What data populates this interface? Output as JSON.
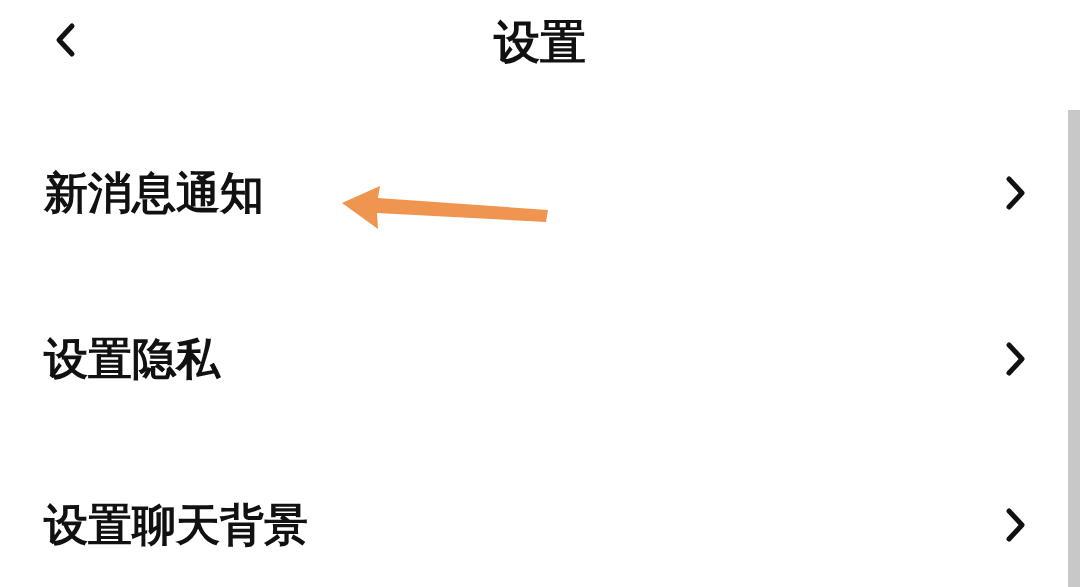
{
  "header": {
    "title": "设置"
  },
  "items": [
    {
      "label": "新消息通知",
      "annotated": true
    },
    {
      "label": "设置隐私",
      "annotated": false
    },
    {
      "label": "设置聊天背景",
      "annotated": false
    }
  ]
}
